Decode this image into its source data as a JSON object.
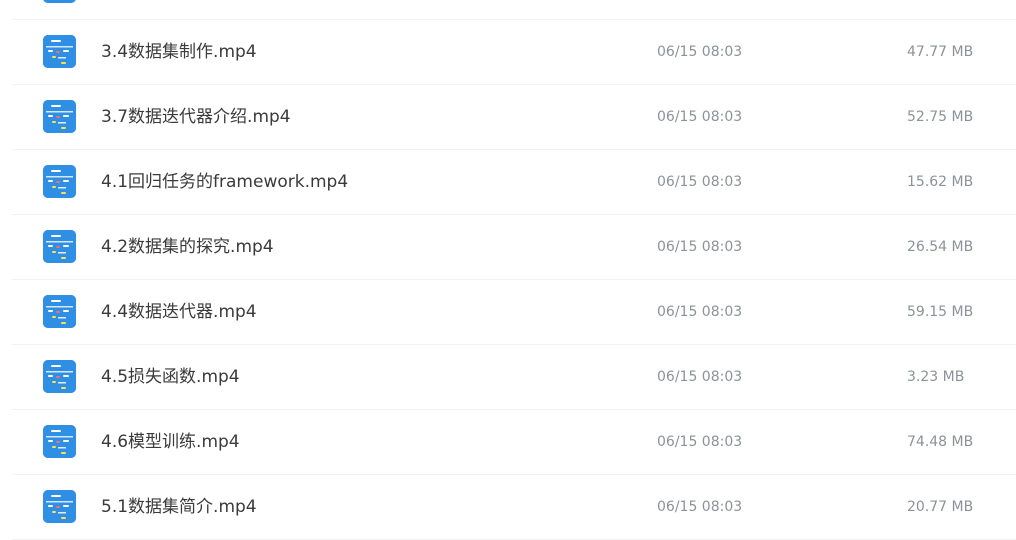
{
  "files": [
    {
      "name": "",
      "date": "",
      "size": "",
      "icon": "video-file-icon",
      "partial": true
    },
    {
      "name": "3.4数据集制作.mp4",
      "date": "06/15 08:03",
      "size": "47.77 MB",
      "icon": "video-file-icon"
    },
    {
      "name": "3.7数据迭代器介绍.mp4",
      "date": "06/15 08:03",
      "size": "52.75 MB",
      "icon": "video-file-icon"
    },
    {
      "name": "4.1回归任务的framework.mp4",
      "date": "06/15 08:03",
      "size": "15.62 MB",
      "icon": "video-file-icon"
    },
    {
      "name": "4.2数据集的探究.mp4",
      "date": "06/15 08:03",
      "size": "26.54 MB",
      "icon": "video-file-icon"
    },
    {
      "name": "4.4数据迭代器.mp4",
      "date": "06/15 08:03",
      "size": "59.15 MB",
      "icon": "video-file-icon"
    },
    {
      "name": "4.5损失函数.mp4",
      "date": "06/15 08:03",
      "size": "3.23 MB",
      "icon": "video-file-icon"
    },
    {
      "name": "4.6模型训练.mp4",
      "date": "06/15 08:03",
      "size": "74.48 MB",
      "icon": "video-file-icon"
    },
    {
      "name": "5.1数据集简介.mp4",
      "date": "06/15 08:03",
      "size": "20.77 MB",
      "icon": "video-file-icon"
    }
  ],
  "colors": {
    "icon_bg": "#2f8fe5",
    "name_text": "#3a3a3a",
    "meta_text": "#8d9299",
    "divider": "#f1f2f4"
  }
}
